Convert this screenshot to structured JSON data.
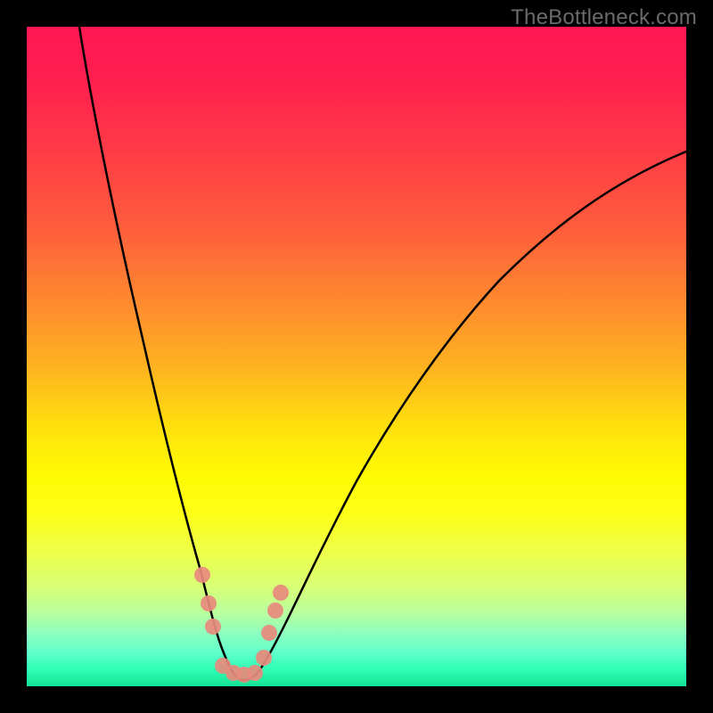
{
  "watermark": "TheBottleneck.com",
  "chart_data": {
    "type": "line",
    "title": "",
    "xlabel": "",
    "ylabel": "",
    "xlim": [
      0,
      100
    ],
    "ylim": [
      0,
      100
    ],
    "series": [
      {
        "name": "curve",
        "x": [
          8,
          10,
          12,
          14,
          16,
          18,
          20,
          22,
          24,
          26,
          27,
          28,
          29,
          30,
          31,
          32,
          33,
          34,
          36,
          38,
          40,
          43,
          46,
          50,
          55,
          60,
          65,
          70,
          75,
          80,
          85,
          90,
          95,
          100
        ],
        "values": [
          100,
          93,
          86,
          79,
          72,
          65,
          57,
          48,
          38,
          26,
          20,
          15,
          10,
          6,
          3,
          2,
          2,
          3,
          6,
          11,
          16,
          22,
          28,
          35,
          42,
          48,
          53,
          58,
          62,
          65,
          68,
          71,
          73,
          75
        ]
      },
      {
        "name": "markers",
        "x": [
          26.5,
          27.2,
          28.8,
          29.5,
          30.5,
          31.5,
          32.5,
          33.3,
          34.0,
          35.0
        ],
        "values": [
          18,
          14,
          6,
          4,
          3,
          2.5,
          3,
          5,
          9,
          14
        ]
      }
    ],
    "gradient_stops": [
      {
        "pos": 0,
        "color": "#ff1751"
      },
      {
        "pos": 30,
        "color": "#fe5b3c"
      },
      {
        "pos": 60,
        "color": "#ffdd0e"
      },
      {
        "pos": 85,
        "color": "#d7ff77"
      },
      {
        "pos": 100,
        "color": "#14e296"
      }
    ]
  }
}
